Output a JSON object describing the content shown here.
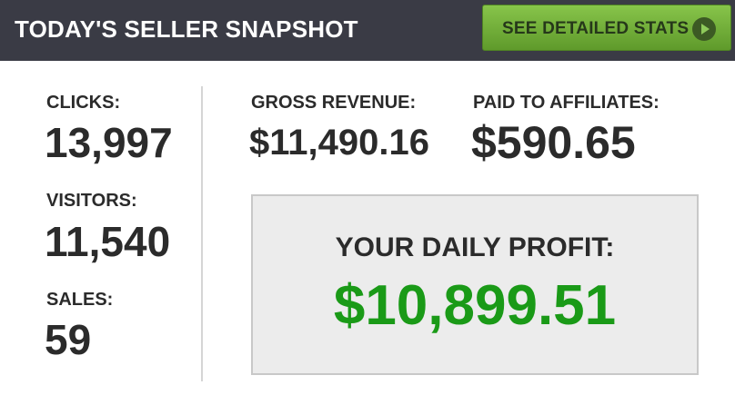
{
  "header": {
    "title": "TODAY'S SELLER SNAPSHOT",
    "button_label": "SEE DETAILED STATS",
    "button_icon": "play-circle-icon",
    "background_color": "#3a3b45",
    "button_color": "#6eab38"
  },
  "left_stats": {
    "clicks": {
      "label": "CLICKS:",
      "value": "13,997"
    },
    "visitors": {
      "label": "VISITORS:",
      "value": "11,540"
    },
    "sales": {
      "label": "SALES:",
      "value": "59"
    }
  },
  "right_stats": {
    "gross_revenue": {
      "label": "GROSS REVENUE:",
      "value": "$11,490.16"
    },
    "paid_to_affiliates": {
      "label": "PAID TO AFFILIATES:",
      "value": "$590.65"
    }
  },
  "profit": {
    "label": "YOUR DAILY PROFIT:",
    "value": "$10,899.51",
    "value_color": "#1a9a17"
  }
}
